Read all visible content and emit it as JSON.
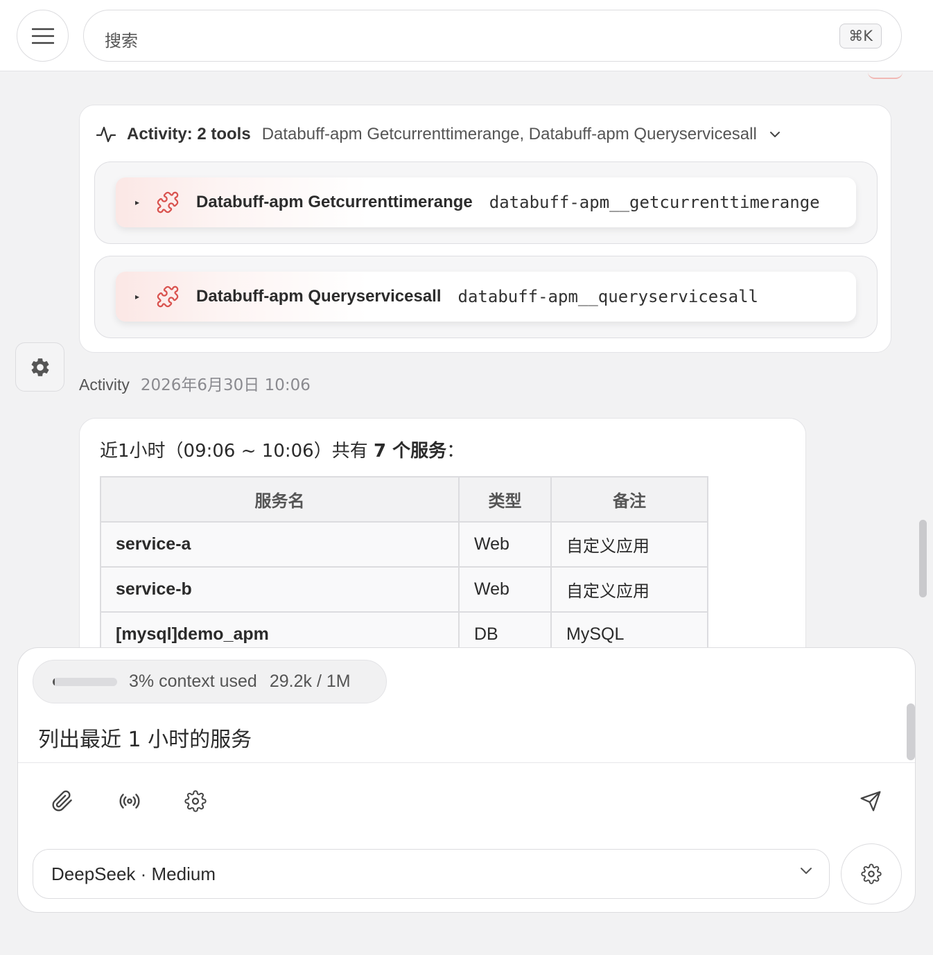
{
  "header": {
    "search_placeholder": "搜索",
    "shortcut": "⌘K"
  },
  "activity": {
    "title": "Activity: 2 tools",
    "summary": "Databuff-apm Getcurrenttimerange, Databuff-apm Queryservicesall",
    "tools": [
      {
        "name": "Databuff-apm Getcurrenttimerange",
        "id": "databuff-apm__getcurrenttimerange",
        "icon": "puzzle-icon"
      },
      {
        "name": "Databuff-apm Queryservicesall",
        "id": "databuff-apm__queryservicesall",
        "icon": "puzzle-icon"
      }
    ]
  },
  "message": {
    "author": "Activity",
    "timestamp": "2026年6月30日 10:06",
    "avatar_icon": "gear-icon",
    "intro_prefix": "近1小时（09:06 ~ 10:06）共有 ",
    "intro_bold": "7 个服务",
    "intro_suffix": "：",
    "table": {
      "headers": [
        "服务名",
        "类型",
        "备注"
      ],
      "rows": [
        [
          "service-a",
          "Web",
          "自定义应用"
        ],
        [
          "service-b",
          "Web",
          "自定义应用"
        ],
        [
          "[mysql]demo_apm",
          "DB",
          "MySQL"
        ]
      ]
    }
  },
  "composer": {
    "context_fraction": 0.03,
    "context_label": "3% context used",
    "context_tokens": "29.2k / 1M",
    "text": "列出最近 1 小时的服务",
    "model": "DeepSeek · Medium",
    "icons": [
      "paperclip-icon",
      "broadcast-icon",
      "gear-icon",
      "send-icon"
    ]
  },
  "colors": {
    "background": "#f2f2f3",
    "tool_accent": "#d9534f",
    "card_border": "#e4e4e7"
  }
}
